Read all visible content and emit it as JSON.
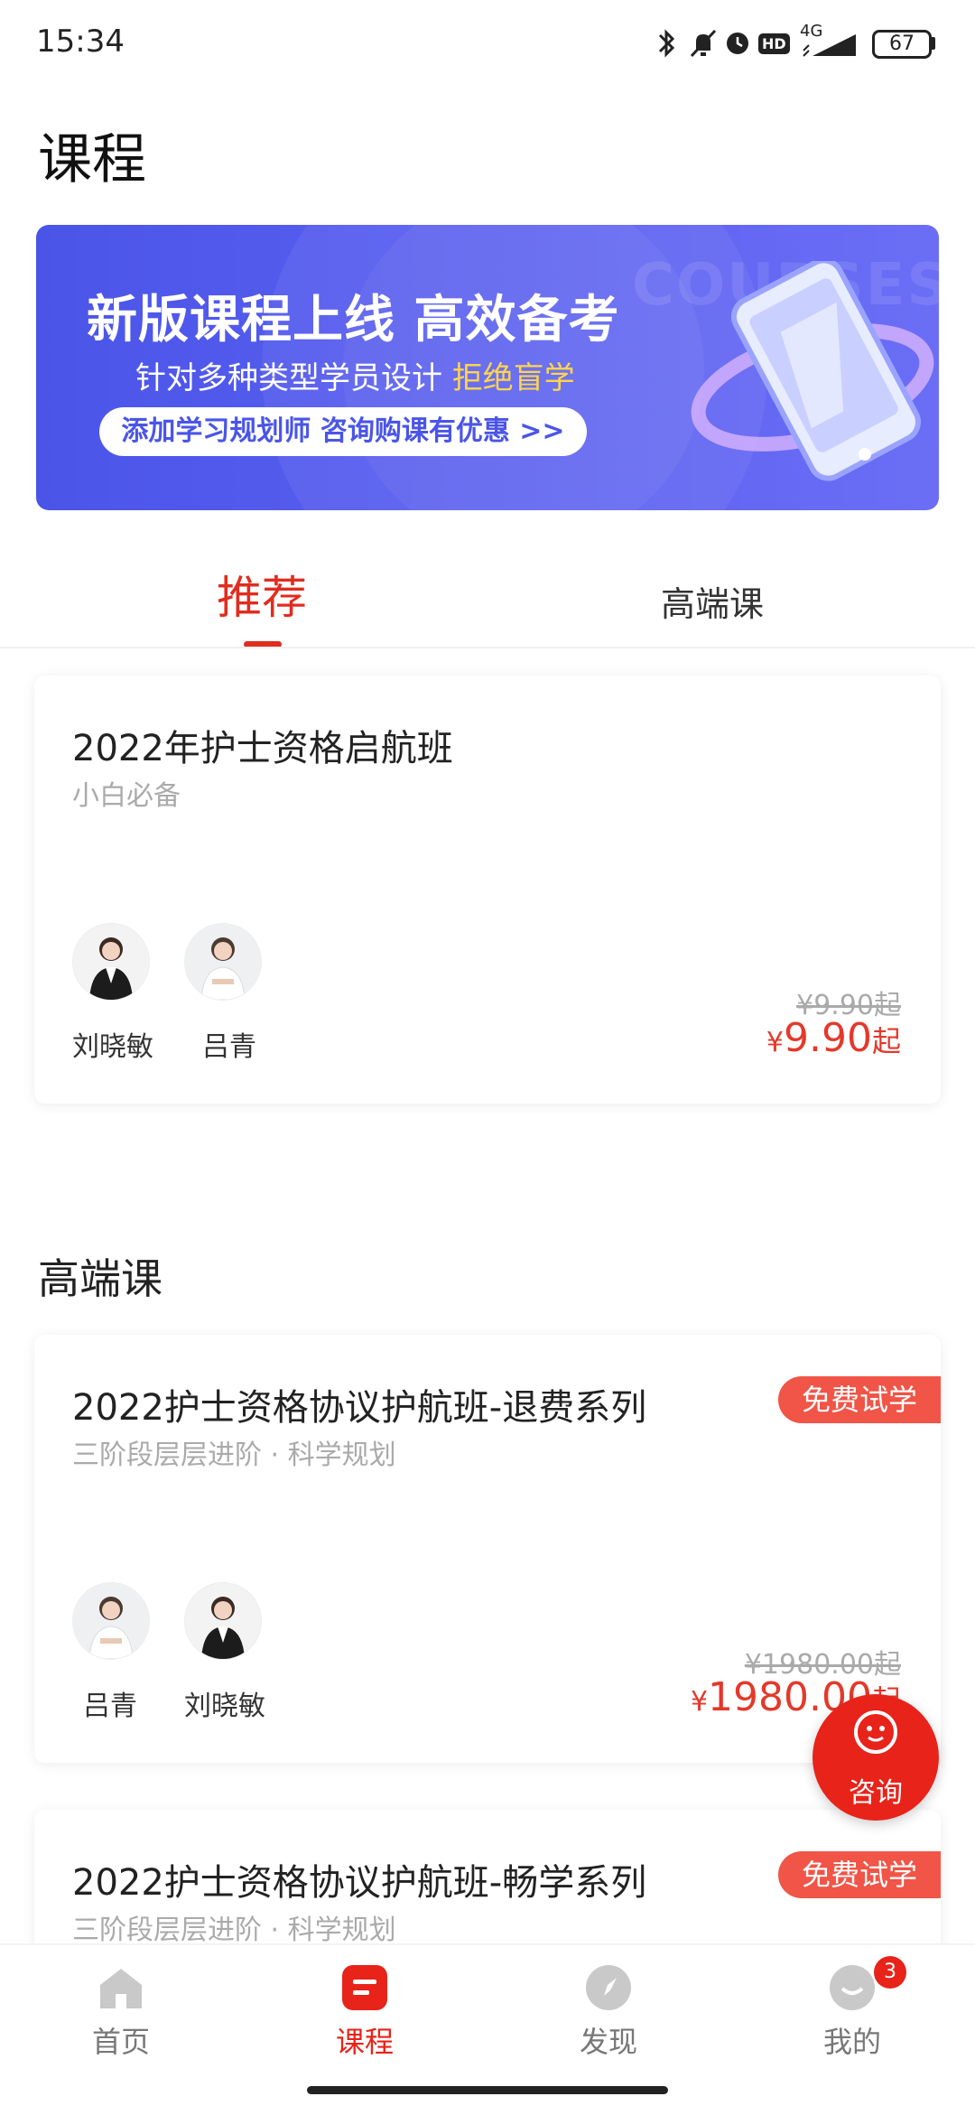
{
  "status_bar": {
    "time": "15:34",
    "network": "4G",
    "battery": "67",
    "hd": "HD"
  },
  "page": {
    "title": "课程"
  },
  "banner": {
    "headline": "新版课程上线  高效备考",
    "sub_prefix": "针对多种类型学员设计 ",
    "sub_highlight": "拒绝盲学",
    "pill": "添加学习规划师 咨询购课有优惠 >>",
    "watermark": "COURSES"
  },
  "tabs": [
    {
      "label": "推荐",
      "active": true
    },
    {
      "label": "高端课",
      "active": false
    }
  ],
  "recommended_course": {
    "title": "2022年护士资格启航班",
    "subtitle": "小白必备",
    "teachers": [
      "刘晓敏",
      "吕青"
    ],
    "original_price": "¥9.90起",
    "price_yen": "¥",
    "price_value": "9.90",
    "price_suffix": "起"
  },
  "section_high_end": {
    "title": "高端课"
  },
  "high_end_courses": [
    {
      "title": "2022护士资格协议护航班-退费系列",
      "subtitle": "三阶段层层进阶  ·  科学规划",
      "badge": "免费试学",
      "teachers": [
        "吕青",
        "刘晓敏"
      ],
      "original_price": "¥1980.00起",
      "price_yen": "¥",
      "price_value": "1980.00",
      "price_suffix": "起"
    },
    {
      "title": "2022护士资格协议护航班-畅学系列",
      "subtitle": "三阶段层层进阶  ·  科学规划",
      "badge": "免费试学"
    }
  ],
  "consult_button": {
    "label": "咨询"
  },
  "bottom_nav": {
    "items": [
      {
        "label": "首页",
        "icon": "home-icon",
        "active": false
      },
      {
        "label": "课程",
        "icon": "course-icon",
        "active": true
      },
      {
        "label": "发现",
        "icon": "compass-icon",
        "active": false
      },
      {
        "label": "我的",
        "icon": "profile-icon",
        "active": false,
        "badge": "3"
      }
    ]
  },
  "colors": {
    "accent": "#e02d1f",
    "banner": "#4a55e8",
    "price": "#e4392b",
    "badge": "#f05547"
  }
}
